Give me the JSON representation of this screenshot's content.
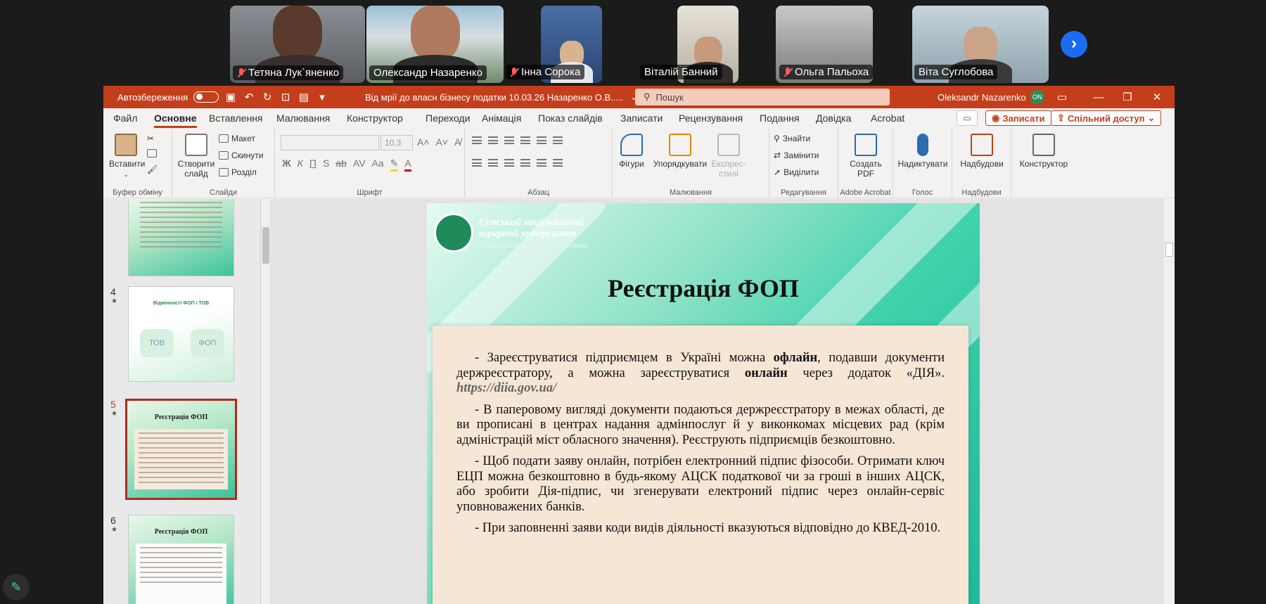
{
  "participants": [
    {
      "name": "Тетяна Лук`яненко",
      "muted": true,
      "active": false
    },
    {
      "name": "Олександр Назаренко",
      "muted": false,
      "active": true
    },
    {
      "name": "Інна Сорока",
      "muted": true,
      "active": false
    },
    {
      "name": "Віталій Банний",
      "muted": false,
      "active": false
    },
    {
      "name": "Ольга Пальоха",
      "muted": true,
      "active": false
    },
    {
      "name": "Віта Суглобова",
      "muted": false,
      "active": false
    }
  ],
  "titlebar": {
    "autosave_label": "Автозбереження",
    "doc_title": "Від мрії до власн бізнесу податки 10.03.26 Назаренко О.В.....",
    "search_placeholder": "Пошук",
    "user_name": "Oleksandr Nazarenko",
    "user_badge": "ON"
  },
  "menu": {
    "tabs": [
      "Файл",
      "Основне",
      "Вставлення",
      "Малювання",
      "Конструктор",
      "Переходи",
      "Анімація",
      "Показ слайдів",
      "Записати",
      "Рецензування",
      "Подання",
      "Довідка",
      "Acrobat"
    ],
    "record_label": "Записати",
    "share_label": "Спільний доступ"
  },
  "ribbon": {
    "paste_label": "Вставити",
    "clipboard_label": "Буфер обміну",
    "new_slide_label": "Створити слайд",
    "layout_label": "Макет",
    "reset_label": "Скинути",
    "section_label": "Розділ",
    "slides_label": "Слайди",
    "font_size": "10,3",
    "font_label": "Шрифт",
    "paragraph_label": "Абзац",
    "shapes_label": "Фігури",
    "arrange_label": "Упорядкувати",
    "quick_styles_label": "Експрес-стилі",
    "drawing_label": "Малювання",
    "find_label": "Знайти",
    "replace_label": "Замінити",
    "select_label": "Виділити",
    "editing_label": "Редагування",
    "create_pdf_label": "Создать PDF",
    "acrobat_label": "Adobe Acrobat",
    "dictate_label": "Надиктувати",
    "voice_label": "Голос",
    "addins_label": "Надбудови",
    "addins_group_label": "Надбудови",
    "designer_label": "Конструктор"
  },
  "thumbnails": {
    "slide4_num": "4",
    "slide4_title": "Відмінності ФОП і ТОВ",
    "slide4_left": "ТОВ",
    "slide4_right": "ФОП",
    "slide5_num": "5",
    "slide5_title": "Реєстрація ФОП",
    "slide6_num": "6",
    "slide6_title": "Реєстрація ФОП"
  },
  "slide": {
    "logo_line1": "Сумський національний",
    "logo_line2": "аграрний університет",
    "logo_sub": "Університет, що вивчає життя",
    "title": "Реєстрація ФОП",
    "p1_a": "- Зареєструватися підприємцем в Україні можна ",
    "p1_b": "офлайн",
    "p1_c": ", подавши документи держреєстратору, а можна зареєструватися ",
    "p1_d": "онлайн",
    "p1_e": " через додаток «ДІЯ». ",
    "p1_link": "https://diia.gov.ua/",
    "p2": "- В паперовому вигляді документи подаються держреєстратору в межах області, де ви прописані в центрах надання адмінпослуг й у виконкомах місцевих рад (крім адміністрацій міст обласного значення). Реєструють підприємців безкоштовно.",
    "p3": "- Щоб подати заяву онлайн, потрібен електронний підпис фізособи. Отримати ключ ЕЦП можна безкоштовно в будь-якому АЦСК податкової чи за гроші в інших АЦСК, або зробити Дія-підпис, чи згенерувати електроний підпис через онлайн-сервіс уповноважених банків.",
    "p4": "- При заповненні заяви коди видів діяльності вказуються відповідно до КВЕД-2010."
  }
}
